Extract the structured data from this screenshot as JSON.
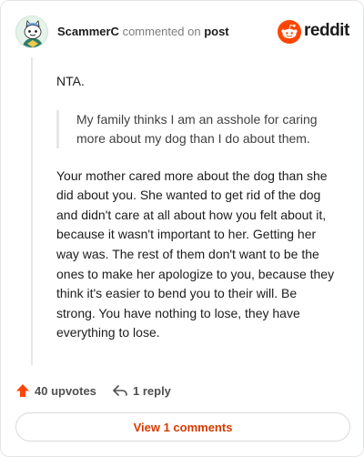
{
  "header": {
    "username": "ScammerC",
    "action_text": "commented on",
    "post_link": "post",
    "logo_text": "reddit"
  },
  "comment": {
    "first_line": "NTA.",
    "quote": "My family thinks I am an asshole for caring more about my dog than I do about them.",
    "body": "Your mother cared more about the dog than she did about you. She wanted to get rid of the dog and didn't care at all about how you felt about it, because it wasn't important to her. Getting her way was. The rest of them don't want to be the ones to make her apologize to you, because they think it's easier to bend you to their will. Be strong. You have nothing to lose, they have everything to lose."
  },
  "actions": {
    "upvotes_label": "40 upvotes",
    "replies_label": "1 reply"
  },
  "view_comments_label": "View 1 comments",
  "colors": {
    "accent": "#d93a00",
    "upvote": "#ff4500",
    "thread_line": "#e6e6e6"
  },
  "icons": {
    "avatar": "snoo-avatar",
    "logo": "reddit-logo-icon",
    "upvote": "upvote-arrow-icon",
    "reply": "reply-arrow-icon"
  }
}
